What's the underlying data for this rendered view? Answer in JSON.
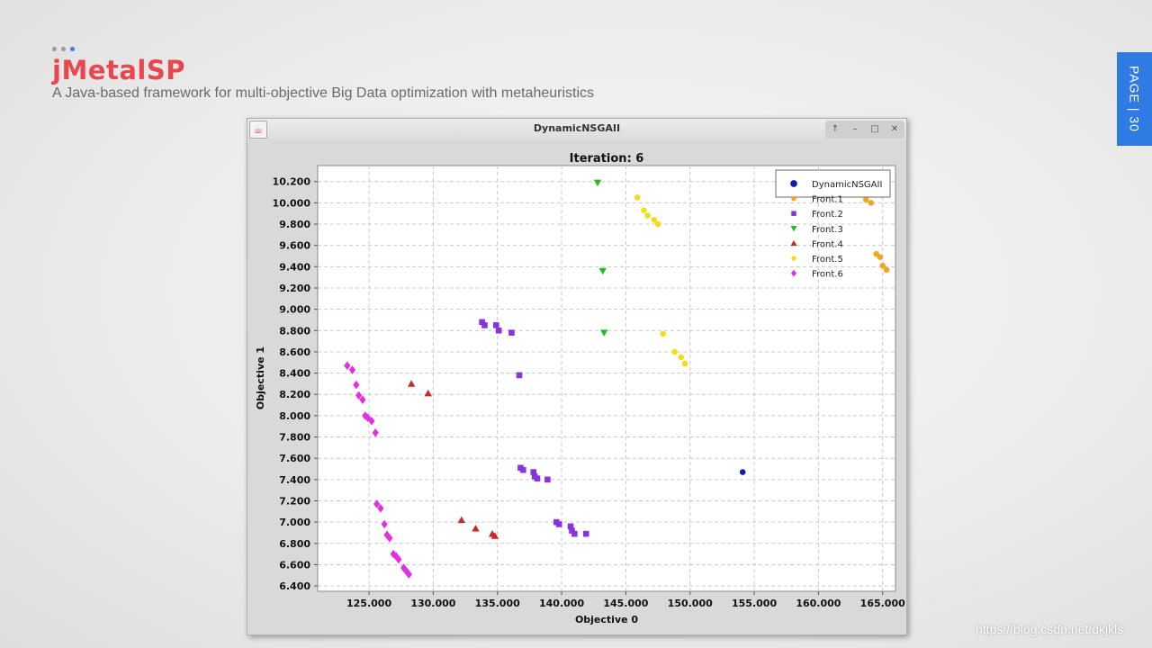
{
  "slide": {
    "title": "jMetalSP",
    "subtitle": "A Java-based framework for multi-objective Big Data optimization with metaheuristics",
    "page_label": "PAGE | 30",
    "watermark": "https://blog.csdn.net/dkjkls",
    "accent_color": "#e8474f",
    "tab_color": "#2f7be3"
  },
  "window": {
    "title": "DynamicNSGAII",
    "icon": "java-app-icon",
    "controls": [
      "up-icon",
      "minimize-icon",
      "maximize-icon",
      "close-icon"
    ]
  },
  "chart_data": {
    "type": "scatter",
    "title": "Iteration: 6",
    "xlabel": "Objective 0",
    "ylabel": "Objective 1",
    "xlim": [
      121000,
      166000
    ],
    "ylim": [
      6.35,
      10.35
    ],
    "xticks": [
      125000,
      130000,
      135000,
      140000,
      145000,
      150000,
      155000,
      160000,
      165000
    ],
    "xtick_labels": [
      "125.000",
      "130.000",
      "135.000",
      "140.000",
      "145.000",
      "150.000",
      "155.000",
      "160.000",
      "165.000"
    ],
    "yticks": [
      6.4,
      6.6,
      6.8,
      7.0,
      7.2,
      7.4,
      7.6,
      7.8,
      8.0,
      8.2,
      8.4,
      8.6,
      8.8,
      9.0,
      9.2,
      9.4,
      9.6,
      9.8,
      10.0,
      10.2
    ],
    "ytick_labels": [
      "6.400",
      "6.600",
      "6.800",
      "7.000",
      "7.200",
      "7.400",
      "7.600",
      "7.800",
      "8.000",
      "8.200",
      "8.400",
      "8.600",
      "8.800",
      "9.000",
      "9.200",
      "9.400",
      "9.600",
      "9.800",
      "10.000",
      "10.200"
    ],
    "grid": true,
    "legend_position": "top-right",
    "series": [
      {
        "name": "DynamicNSGAII",
        "marker": "circle",
        "color": "#1a1aa8",
        "points": [
          [
            154100,
            7.47
          ]
        ]
      },
      {
        "name": "Front.1",
        "marker": "circle",
        "color": "#f0a820",
        "points": [
          [
            163700,
            10.03
          ],
          [
            164100,
            10.0
          ],
          [
            164500,
            9.52
          ],
          [
            164800,
            9.49
          ],
          [
            165000,
            9.41
          ],
          [
            165300,
            9.37
          ]
        ]
      },
      {
        "name": "Front.2",
        "marker": "square",
        "color": "#8833dd",
        "points": [
          [
            133800,
            8.88
          ],
          [
            134000,
            8.85
          ],
          [
            134900,
            8.85
          ],
          [
            135100,
            8.8
          ],
          [
            136100,
            8.78
          ],
          [
            136700,
            8.38
          ],
          [
            136800,
            7.51
          ],
          [
            137000,
            7.49
          ],
          [
            137800,
            7.47
          ],
          [
            137900,
            7.43
          ],
          [
            138100,
            7.41
          ],
          [
            138900,
            7.4
          ],
          [
            139600,
            7.0
          ],
          [
            139800,
            6.98
          ],
          [
            140700,
            6.96
          ],
          [
            140800,
            6.92
          ],
          [
            141000,
            6.89
          ],
          [
            141900,
            6.89
          ]
        ]
      },
      {
        "name": "Front.3",
        "marker": "triangle-down",
        "color": "#22bb22",
        "points": [
          [
            142800,
            10.19
          ],
          [
            143200,
            9.36
          ],
          [
            143300,
            8.78
          ]
        ]
      },
      {
        "name": "Front.4",
        "marker": "triangle-up",
        "color": "#c82828",
        "points": [
          [
            128300,
            8.3
          ],
          [
            129600,
            8.21
          ],
          [
            132200,
            7.02
          ],
          [
            133300,
            6.94
          ],
          [
            134600,
            6.89
          ],
          [
            134800,
            6.87
          ]
        ]
      },
      {
        "name": "Front.5",
        "marker": "circle",
        "color": "#f4dc18",
        "points": [
          [
            145900,
            10.05
          ],
          [
            146400,
            9.93
          ],
          [
            146700,
            9.88
          ],
          [
            147200,
            9.84
          ],
          [
            147500,
            9.8
          ],
          [
            147900,
            8.77
          ],
          [
            148800,
            8.6
          ],
          [
            149300,
            8.55
          ],
          [
            149600,
            8.49
          ]
        ]
      },
      {
        "name": "Front.6",
        "marker": "diamond",
        "color": "#e030e0",
        "points": [
          [
            123300,
            8.47
          ],
          [
            123700,
            8.43
          ],
          [
            124000,
            8.29
          ],
          [
            124200,
            8.19
          ],
          [
            124500,
            8.15
          ],
          [
            124700,
            8.0
          ],
          [
            124900,
            7.98
          ],
          [
            125200,
            7.95
          ],
          [
            125500,
            7.84
          ],
          [
            125600,
            7.17
          ],
          [
            125900,
            7.13
          ],
          [
            126200,
            6.98
          ],
          [
            126400,
            6.88
          ],
          [
            126600,
            6.85
          ],
          [
            126900,
            6.7
          ],
          [
            127100,
            6.68
          ],
          [
            127300,
            6.65
          ],
          [
            127700,
            6.57
          ],
          [
            127900,
            6.54
          ],
          [
            128100,
            6.51
          ]
        ]
      }
    ]
  }
}
